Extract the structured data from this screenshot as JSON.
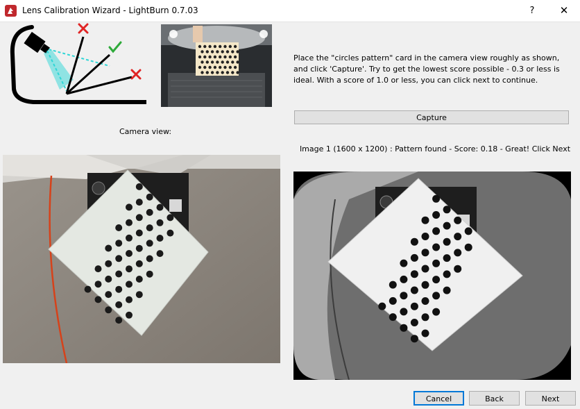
{
  "window": {
    "title": "Lens Calibration Wizard - LightBurn 0.7.03",
    "help_label": "?",
    "close_label": "✕"
  },
  "instructions": "Place the \"circles pattern\" card in the camera view roughly as shown, and click 'Capture'.  Try to get the lowest score possible - 0.3 or less is ideal.  With a score of 1.0 or less, you can click next to continue.",
  "capture_label": "Capture",
  "camera_view_label": "Camera view:",
  "status_text": "Image 1 (1600 x 1200) : Pattern found - Score: 0.18 - Great! Click Next",
  "buttons": {
    "cancel": "Cancel",
    "back": "Back",
    "next": "Next"
  },
  "colors": {
    "accent": "#0078d7",
    "brand_red": "#c0282d",
    "good": "#2eaa3a",
    "bad": "#e02424",
    "beam": "#2ed6d6"
  }
}
